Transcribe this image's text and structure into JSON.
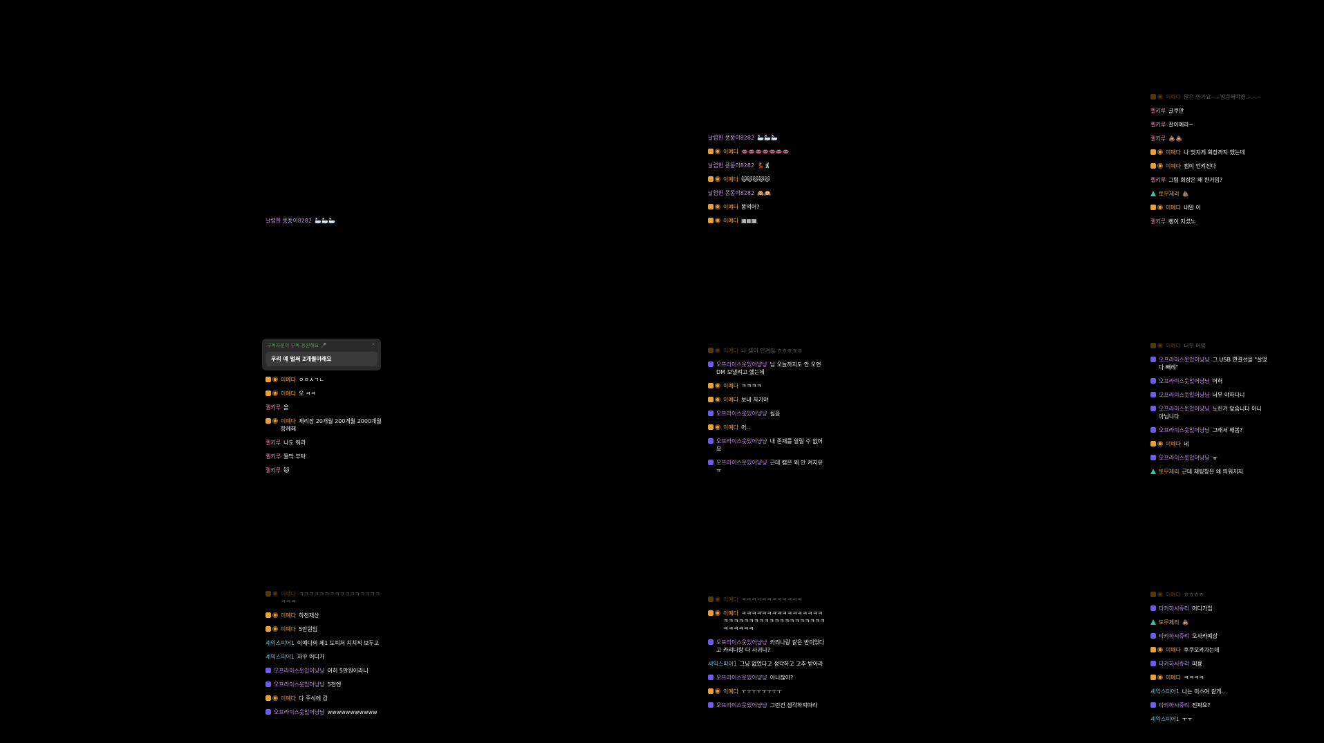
{
  "notice": {
    "header": "구독자분이 구독 응원해요 🎤",
    "close": "×",
    "message": "우리 예 벌써 2개월이래요"
  },
  "panels": [
    {
      "id": "p1",
      "messages": [
        {
          "badges": [],
          "nick": "날렵한 퐁퐁이8282",
          "nc": "purple",
          "text": "🦢🦢🦢"
        }
      ]
    },
    {
      "id": "p2",
      "messages": [
        {
          "badges": [
            "sq",
            "mo"
          ],
          "nick": "이예다",
          "nc": "orange",
          "text": "ㅇㅇㅅㄱㄴ"
        },
        {
          "badges": [
            "sq",
            "mo"
          ],
          "nick": "이예다",
          "nc": "orange",
          "text": "오 ㅋㅋ"
        },
        {
          "badges": [],
          "nick": "젤키루",
          "nc": "pink",
          "text": "올"
        },
        {
          "badges": [
            "sq",
            "mo"
          ],
          "nick": "이예다",
          "nc": "orange",
          "text": "제리장 20개월 200개월 2000개월 함께해"
        },
        {
          "badges": [],
          "nick": "젤키루",
          "nc": "pink",
          "text": "나도 줘라"
        },
        {
          "badges": [],
          "nick": "젤키루",
          "nc": "pink",
          "text": "짤막 부탁"
        },
        {
          "badges": [],
          "nick": "젤키루",
          "nc": "pink",
          "text": "🐱"
        }
      ]
    },
    {
      "id": "p3",
      "messages": [
        {
          "badges": [
            "sq",
            "mo"
          ],
          "nick": "이예다",
          "nc": "orange",
          "text": "ㅋㅋㅋㅋㅋㅋㅋㅋㅋㅋㅋㅋㅋㅋㅋㅋㅋㅋㅋ",
          "faded": true
        },
        {
          "badges": [
            "sq",
            "mo"
          ],
          "nick": "이예다",
          "nc": "orange",
          "text": "하천재산"
        },
        {
          "badges": [
            "sq",
            "mo"
          ],
          "nick": "이예다",
          "nc": "orange",
          "text": "5만원임"
        },
        {
          "badges": [],
          "nick": "셰익스피어1",
          "nc": "teal",
          "text": "이예다의 제1 도피처 치치직 보두고"
        },
        {
          "badges": [],
          "nick": "셰익스피어1",
          "nc": "teal",
          "text": "자꾸 어디가"
        },
        {
          "badges": [
            "he"
          ],
          "nick": "오프라이스웃있어냥냥",
          "nc": "purple",
          "text": "어허 5만원이라니"
        },
        {
          "badges": [
            "he"
          ],
          "nick": "오프라이스웃있어냥냥",
          "nc": "purple",
          "text": "5천엔"
        },
        {
          "badges": [
            "sq",
            "mo"
          ],
          "nick": "이예다",
          "nc": "orange",
          "text": "다 주식에 감"
        },
        {
          "badges": [
            "he"
          ],
          "nick": "오프라이스웃있어냥냥",
          "nc": "purple",
          "text": "wwwwwwwwwww"
        }
      ]
    },
    {
      "id": "p4",
      "messages": [
        {
          "badges": [],
          "nick": "날렵한 퐁퐁이8282",
          "nc": "purple",
          "text": "🦢🦢🦢"
        },
        {
          "badges": [
            "sq",
            "mo"
          ],
          "nick": "이예다",
          "nc": "orange",
          "text": "👄👄👄👄👄👄👄"
        },
        {
          "badges": [],
          "nick": "날렵한 퐁퐁이8282",
          "nc": "purple",
          "text": "💃🕺"
        },
        {
          "badges": [
            "sq",
            "mo"
          ],
          "nick": "이예다",
          "nc": "orange",
          "text": "🐱🐱🐱🐱🐱"
        },
        {
          "badges": [],
          "nick": "날렵한 퐁퐁이8282",
          "nc": "purple",
          "text": "🙈🙉"
        },
        {
          "badges": [
            "sq",
            "mo"
          ],
          "nick": "이예다",
          "nc": "orange",
          "text": "똥먹어?"
        },
        {
          "badges": [
            "sq",
            "mo"
          ],
          "nick": "이예다",
          "nc": "orange",
          "text": "▦▦▦"
        }
      ]
    },
    {
      "id": "p5",
      "messages": [
        {
          "badges": [
            "sq",
            "mo"
          ],
          "nick": "이예다",
          "nc": "orange",
          "text": "나 캠이 안켜짐 ㅎㅎㅎㅎㅎ",
          "faded": true
        },
        {
          "badges": [
            "he"
          ],
          "nick": "오프라이스웃있어냥냥",
          "nc": "purple",
          "text": "님 오늘까지도 안 오면 DM 보낼려고 했는데"
        },
        {
          "badges": [
            "sq",
            "mo"
          ],
          "nick": "이예다",
          "nc": "orange",
          "text": "ㅋㅋㅋㅋ"
        },
        {
          "badges": [
            "sq",
            "mo"
          ],
          "nick": "이예다",
          "nc": "orange",
          "text": "보내 자기야"
        },
        {
          "badges": [
            "he"
          ],
          "nick": "오프라이스웃있어냥냥",
          "nc": "purple",
          "text": "싫음"
        },
        {
          "badges": [
            "sq",
            "mo"
          ],
          "nick": "이예다",
          "nc": "orange",
          "text": "어.."
        },
        {
          "badges": [
            "he"
          ],
          "nick": "오프라이스웃있어냥냥",
          "nc": "purple",
          "text": "내 존재를 알릴 수 없어요"
        },
        {
          "badges": [
            "he"
          ],
          "nick": "오프라이스웃있어냥냥",
          "nc": "purple",
          "text": "근데 캠은 왜 안 켜지유 ㅠ"
        }
      ]
    },
    {
      "id": "p6",
      "messages": [
        {
          "badges": [
            "sq",
            "mo"
          ],
          "nick": "이예다",
          "nc": "orange",
          "text": "ㅋㅋㅋㅋㅋㅋㅋㅋㅋㅋㅋㅋ",
          "faded": true
        },
        {
          "badges": [
            "sq",
            "mo"
          ],
          "nick": "이예다",
          "nc": "orange",
          "text": "ㅋㅋㅋㅋㅋㅋㅋㅋㅋㅋㅋㅋㅋㅋㅋㅋㅋㅋㅋㅋㅋㅋㅋㅋㅋㅋㅋㅋㅋㅋㅋㅋㅋㅋㅋㅋㅋㅋㅋㅋㅋㅋ"
        },
        {
          "badges": [
            "he"
          ],
          "nick": "오프라이스웃있어냥냥",
          "nc": "purple",
          "text": "카리나랑 같은 반이었다고 카리나랑 다 사귀나?"
        },
        {
          "badges": [],
          "nick": "셰익스피어1",
          "nc": "teal",
          "text": "그냥 없었다고 생각하고 고추 받아라"
        },
        {
          "badges": [
            "he"
          ],
          "nick": "오프라이스웃있어냥냥",
          "nc": "purple",
          "text": "아니잖아?"
        },
        {
          "badges": [
            "sq",
            "mo"
          ],
          "nick": "이예다",
          "nc": "orange",
          "text": "ㅜㅜㅜㅜㅜㅜㅜㅜ"
        },
        {
          "badges": [
            "he"
          ],
          "nick": "오프라이스웃있어냥냥",
          "nc": "purple",
          "text": "그런건 생각하지마라"
        }
      ]
    },
    {
      "id": "p7",
      "messages": [
        {
          "badges": [
            "sq",
            "mo"
          ],
          "nick": "이예다",
          "nc": "orange",
          "text": "많은 인기요~~방송해야겠 ~~~",
          "faded": true
        },
        {
          "badges": [],
          "nick": "젤키루",
          "nc": "pink",
          "text": "글쿠만"
        },
        {
          "badges": [],
          "nick": "젤키루",
          "nc": "pink",
          "text": "잘아예라~"
        },
        {
          "badges": [],
          "nick": "젤키루",
          "nc": "pink",
          "text": "💩💩"
        },
        {
          "badges": [
            "sq",
            "mo"
          ],
          "nick": "이예다",
          "nc": "orange",
          "text": "나 멋지게 회장까지 했는데"
        },
        {
          "badges": [
            "sq",
            "mo"
          ],
          "nick": "이예다",
          "nc": "orange",
          "text": "캠이 안켜진다"
        },
        {
          "badges": [],
          "nick": "젤키루",
          "nc": "pink",
          "text": "그럼 회장은 왜 한거임?"
        },
        {
          "badges": [
            "tri"
          ],
          "nick": "토무제리",
          "nc": "orange",
          "text": "💩"
        },
        {
          "badges": [
            "sq",
            "mo"
          ],
          "nick": "이예다",
          "nc": "orange",
          "text": "내말 이"
        },
        {
          "badges": [],
          "nick": "젤키루",
          "nc": "pink",
          "text": "뻥이 지섰노"
        }
      ]
    },
    {
      "id": "p8",
      "messages": [
        {
          "badges": [
            "sq",
            "mo"
          ],
          "nick": "이예다",
          "nc": "orange",
          "text": "너무 어렵",
          "faded": true
        },
        {
          "badges": [
            "he"
          ],
          "nick": "오프라이스웃있어냥냥",
          "nc": "purple",
          "text": "그 USB 연결선을 \"살었다 빼레\""
        },
        {
          "badges": [
            "he"
          ],
          "nick": "오프라이스웃있어냥냥",
          "nc": "purple",
          "text": "어허"
        },
        {
          "badges": [
            "he"
          ],
          "nick": "오프라이스웃있어냥냥",
          "nc": "purple",
          "text": "너무 야하다니"
        },
        {
          "badges": [
            "he"
          ],
          "nick": "오프라이스웃있어냥냥",
          "nc": "purple",
          "text": "노린거 맞습니다 아니 아닙니다"
        },
        {
          "badges": [
            "he"
          ],
          "nick": "오프라이스웃있어냥냥",
          "nc": "purple",
          "text": "그래서 해봄?"
        },
        {
          "badges": [
            "sq",
            "mo"
          ],
          "nick": "이예다",
          "nc": "orange",
          "text": "네"
        },
        {
          "badges": [
            "he"
          ],
          "nick": "오프라이스웃있어냥냥",
          "nc": "purple",
          "text": "ㅠ"
        },
        {
          "badges": [
            "tri"
          ],
          "nick": "토무제리",
          "nc": "orange",
          "text": "근데 채팅창은 왜 띄워지지"
        }
      ]
    },
    {
      "id": "p9",
      "messages": [
        {
          "badges": [
            "sq",
            "mo"
          ],
          "nick": "이예다",
          "nc": "orange",
          "text": "ㅎㅎㅎㅎ",
          "faded": true
        },
        {
          "badges": [
            "he"
          ],
          "nick": "타카하시쥬리",
          "nc": "purple",
          "text": "어디가임"
        },
        {
          "badges": [
            "tri"
          ],
          "nick": "토무제리",
          "nc": "orange",
          "text": "💩"
        },
        {
          "badges": [
            "he"
          ],
          "nick": "타카하시쥬리",
          "nc": "purple",
          "text": "오사카예상"
        },
        {
          "badges": [
            "sq",
            "mo"
          ],
          "nick": "이예다",
          "nc": "orange",
          "text": "후쿠오카가는데"
        },
        {
          "badges": [
            "he"
          ],
          "nick": "타카하시쥬리",
          "nc": "purple",
          "text": "띠용"
        },
        {
          "badges": [
            "sq",
            "mo"
          ],
          "nick": "이예다",
          "nc": "orange",
          "text": "ㅋㅋㅋㅋ"
        },
        {
          "badges": [],
          "nick": "셰익스피어1",
          "nc": "teal",
          "text": "나는 미스여 같게.."
        },
        {
          "badges": [
            "he"
          ],
          "nick": "타카하시쥬리",
          "nc": "purple",
          "text": "진짜요?"
        },
        {
          "badges": [],
          "nick": "셰익스피어1",
          "nc": "teal",
          "text": "ㅜㅜ"
        }
      ]
    }
  ]
}
